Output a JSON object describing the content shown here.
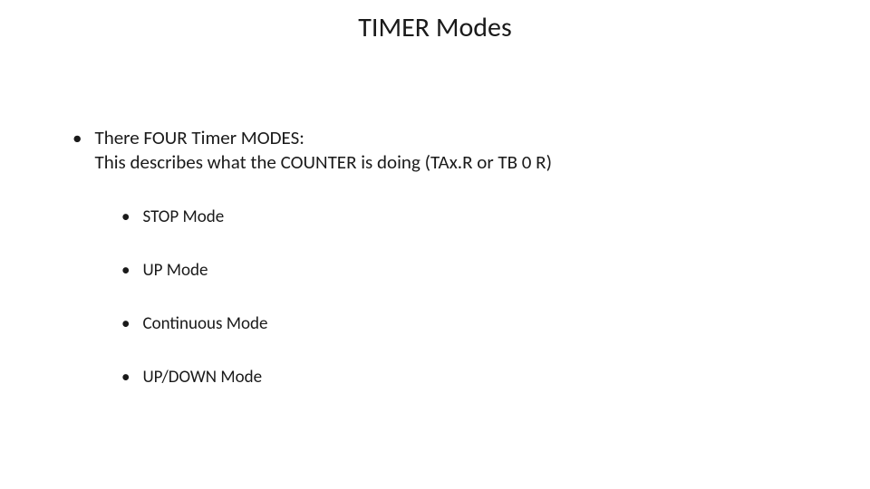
{
  "title": "TIMER Modes",
  "intro": {
    "line1": "There FOUR Timer MODES:",
    "line2": "This describes what the COUNTER is doing (TAx.R or TB 0 R)"
  },
  "modes": {
    "item0": "STOP Mode",
    "item1": "UP Mode",
    "item2": "Continuous Mode",
    "item3": "UP/DOWN Mode"
  }
}
